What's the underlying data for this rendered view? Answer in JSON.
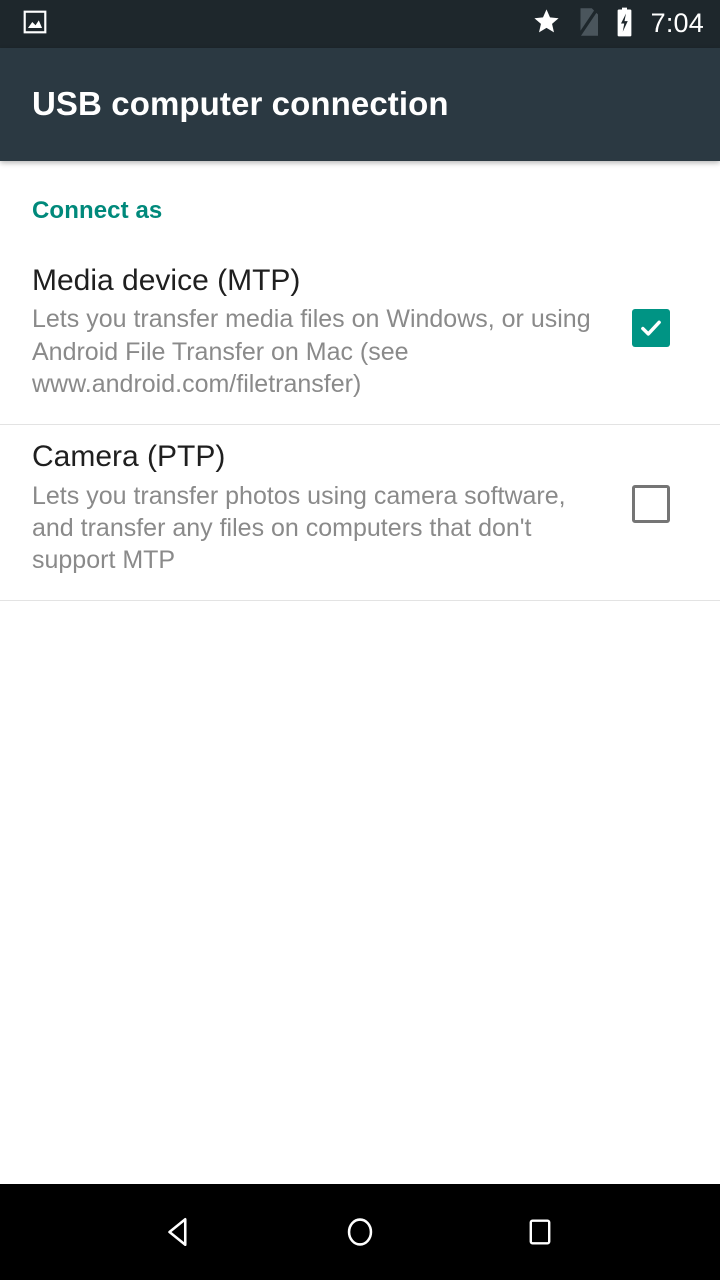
{
  "status_bar": {
    "notification_icon": "image-notification-icon",
    "icons": [
      "star-icon",
      "no-sim-icon",
      "battery-charging-icon"
    ],
    "clock": "7:04",
    "background_color": "#1e272c",
    "foreground_color": "#ffffff"
  },
  "action_bar": {
    "title": "USB computer connection",
    "background_color": "#2b3942",
    "title_color": "#ffffff"
  },
  "content": {
    "section_header": "Connect as",
    "section_header_color": "#00897b",
    "options": [
      {
        "title": "Media device (MTP)",
        "description": "Lets you transfer media files on Windows, or using Android File Transfer on Mac (see www.android.com/filetransfer)",
        "checked": true,
        "checkbox_color": "#009484"
      },
      {
        "title": "Camera (PTP)",
        "description": "Lets you transfer photos using camera software, and transfer any files on computers that don't support MTP",
        "checked": false,
        "checkbox_color": "#757575"
      }
    ]
  },
  "nav_bar": {
    "background_color": "#000000",
    "buttons": [
      "back-icon",
      "home-icon",
      "recents-icon"
    ]
  }
}
